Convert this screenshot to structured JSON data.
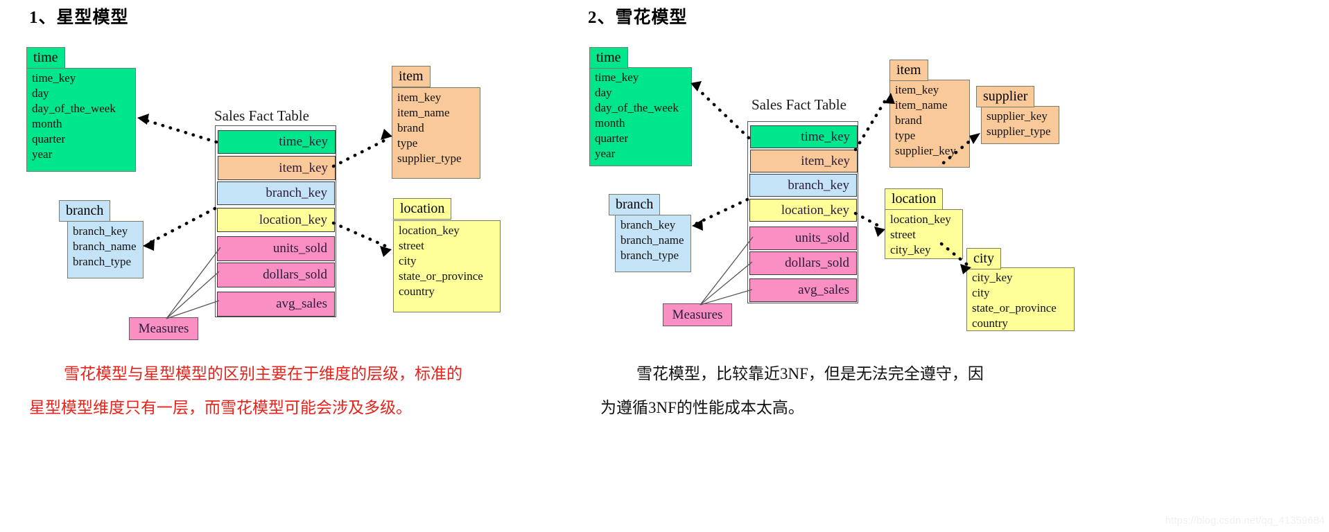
{
  "page": {
    "watermark": "https://blog.csdn.net/qq_41359684",
    "colors": {
      "green": "#00e68c",
      "orange": "#fac999",
      "blue": "#c5e3f6",
      "yellow": "#ffff99",
      "pink": "#fa8fc4",
      "caption_red": "#e8221a",
      "caption_black": "#111111"
    }
  },
  "star": {
    "title": "1、星型模型",
    "fact_title": "Sales Fact Table",
    "fact_rows": [
      {
        "label": "time_key",
        "color": "green"
      },
      {
        "label": "item_key",
        "color": "orange"
      },
      {
        "label": "branch_key",
        "color": "blue"
      },
      {
        "label": "location_key",
        "color": "yellow"
      },
      {
        "label": "units_sold",
        "color": "pink"
      },
      {
        "label": "dollars_sold",
        "color": "pink"
      },
      {
        "label": "avg_sales",
        "color": "pink"
      }
    ],
    "measures_label": "Measures",
    "time": {
      "name": "time",
      "fields": [
        "time_key",
        "day",
        "day_of_the_week",
        "month",
        "quarter",
        "year"
      ]
    },
    "item": {
      "name": "item",
      "fields": [
        "item_key",
        "item_name",
        "brand",
        "type",
        "supplier_type"
      ]
    },
    "branch": {
      "name": "branch",
      "fields": [
        "branch_key",
        "branch_name",
        "branch_type"
      ]
    },
    "location": {
      "name": "location",
      "fields": [
        "location_key",
        "street",
        "city",
        "state_or_province",
        "country"
      ]
    },
    "caption_line1": "雪花模型与星型模型的区别主要在于维度的层级，标准的",
    "caption_line2": "星型模型维度只有一层，而雪花模型可能会涉及多级。"
  },
  "snowflake": {
    "title": "2、雪花模型",
    "fact_title": "Sales Fact Table",
    "fact_rows": [
      {
        "label": "time_key",
        "color": "green"
      },
      {
        "label": "item_key",
        "color": "orange"
      },
      {
        "label": "branch_key",
        "color": "blue"
      },
      {
        "label": "location_key",
        "color": "yellow"
      },
      {
        "label": "units_sold",
        "color": "pink"
      },
      {
        "label": "dollars_sold",
        "color": "pink"
      },
      {
        "label": "avg_sales",
        "color": "pink"
      }
    ],
    "measures_label": "Measures",
    "time": {
      "name": "time",
      "fields": [
        "time_key",
        "day",
        "day_of_the_week",
        "month",
        "quarter",
        "year"
      ]
    },
    "item": {
      "name": "item",
      "fields": [
        "item_key",
        "item_name",
        "brand",
        "type",
        "supplier_key"
      ]
    },
    "supplier": {
      "name": "supplier",
      "fields": [
        "supplier_key",
        "supplier_type"
      ]
    },
    "branch": {
      "name": "branch",
      "fields": [
        "branch_key",
        "branch_name",
        "branch_type"
      ]
    },
    "location": {
      "name": "location",
      "fields": [
        "location_key",
        "street",
        "city_key"
      ]
    },
    "city": {
      "name": "city",
      "fields": [
        "city_key",
        "city",
        "state_or_province",
        "country"
      ]
    },
    "caption_line1": "雪花模型，比较靠近3NF，但是无法完全遵守，因",
    "caption_line2": "为遵循3NF的性能成本太高。"
  }
}
